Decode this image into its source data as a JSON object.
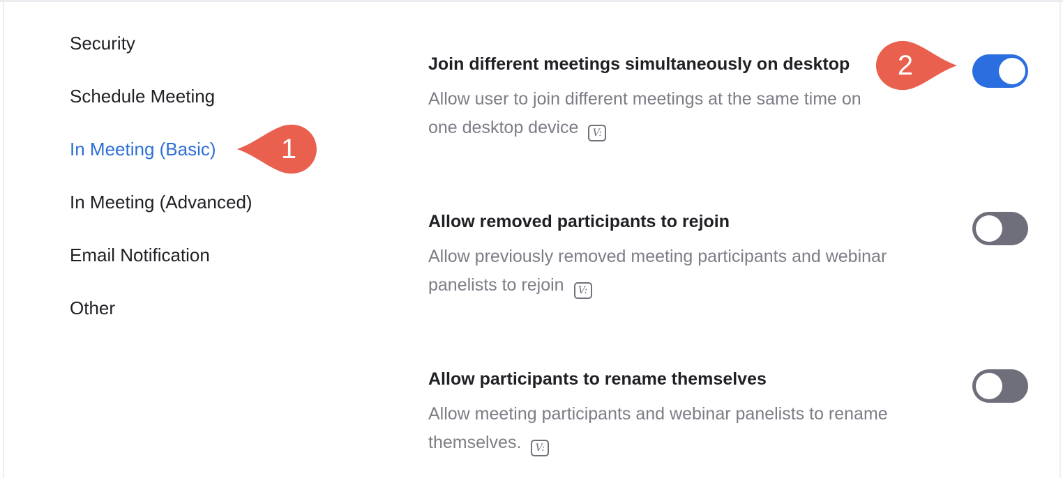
{
  "sidebar": {
    "items": [
      {
        "label": "Security",
        "active": false
      },
      {
        "label": "Schedule Meeting",
        "active": false
      },
      {
        "label": "In Meeting (Basic)",
        "active": true
      },
      {
        "label": "In Meeting (Advanced)",
        "active": false
      },
      {
        "label": "Email Notification",
        "active": false
      },
      {
        "label": "Other",
        "active": false
      }
    ]
  },
  "settings": [
    {
      "title": "Join different meetings simultaneously on desktop",
      "desc_line1": "Allow user to join different meetings at the same time on",
      "desc_line2": "one desktop device",
      "enabled": true
    },
    {
      "title": "Allow removed participants to rejoin",
      "desc_line1": "Allow previously removed meeting participants and webinar",
      "desc_line2": "panelists to rejoin",
      "enabled": false
    },
    {
      "title": "Allow participants to rename themselves",
      "desc_line1": "Allow meeting participants and webinar panelists to rename",
      "desc_line2": "themselves.",
      "enabled": false
    }
  ],
  "info_icon_glyph": "V:",
  "callouts": [
    {
      "label": "1"
    },
    {
      "label": "2"
    }
  ],
  "colors": {
    "accent": "#2d6fd6",
    "toggle_on": "#2a6ee0",
    "toggle_off": "#6e6f7b",
    "callout": "#e9604f"
  }
}
